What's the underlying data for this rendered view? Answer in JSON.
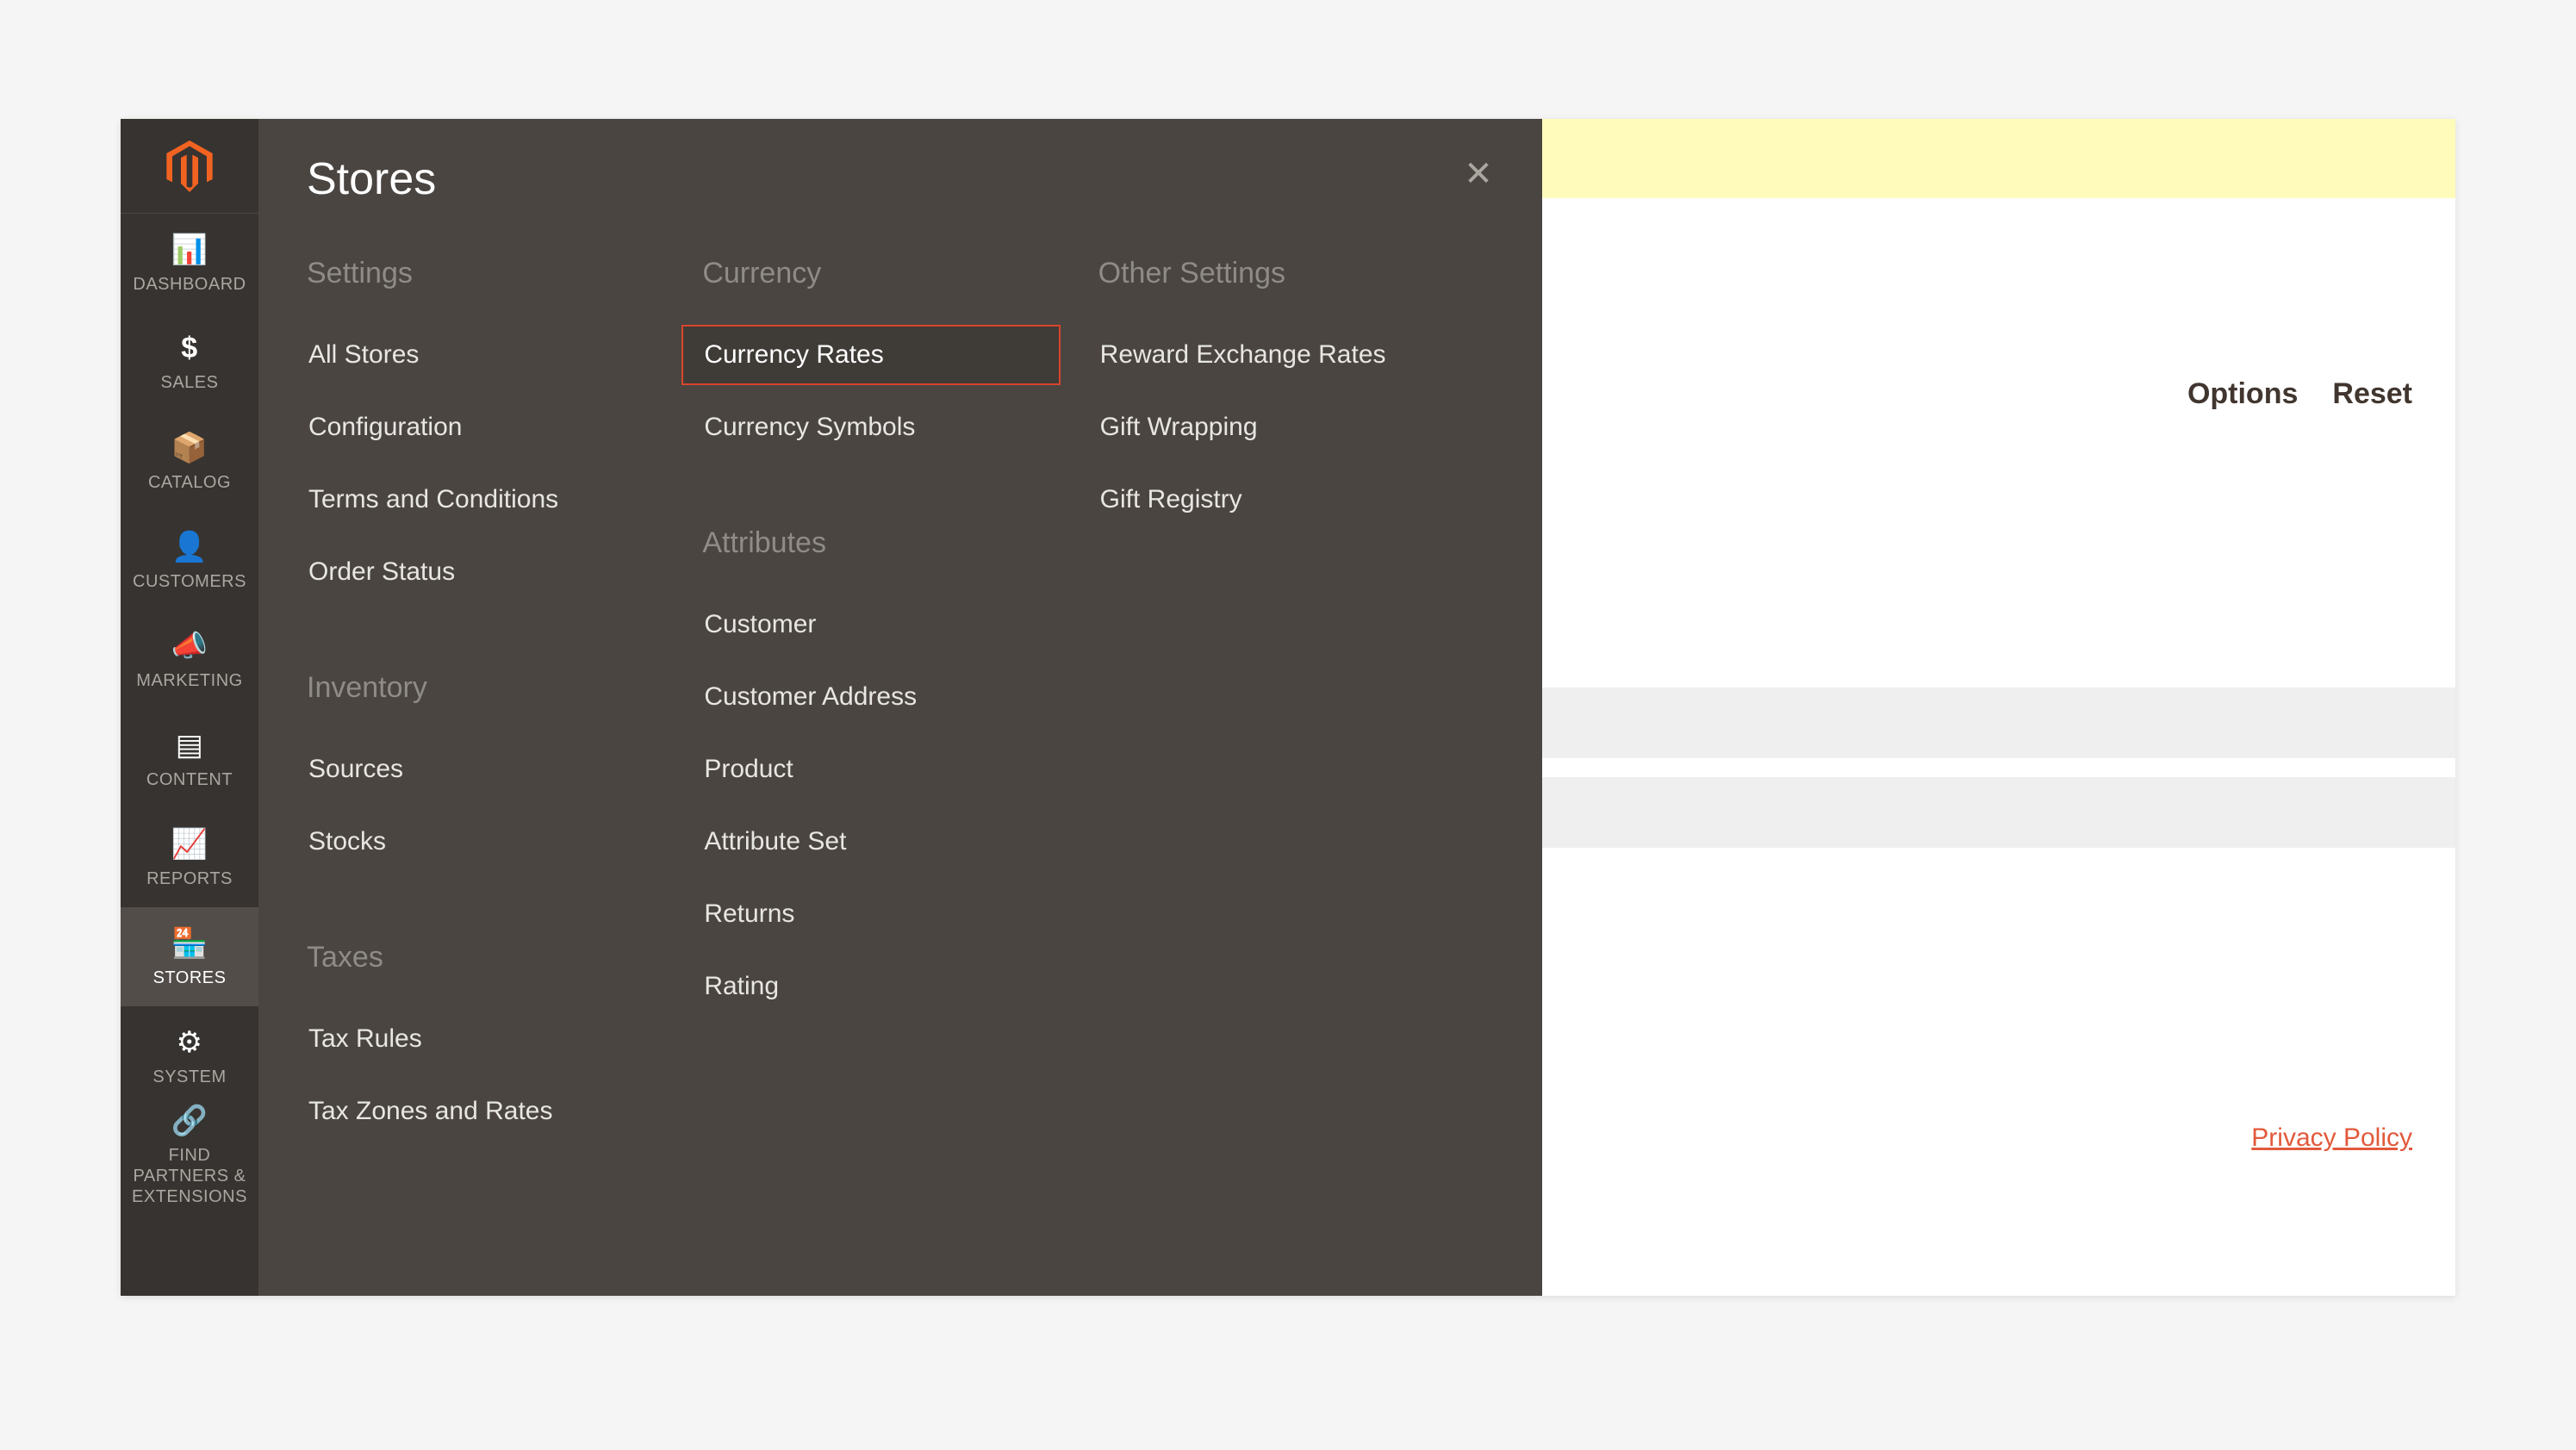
{
  "flyout": {
    "title": "Stores",
    "columns": [
      {
        "groups": [
          {
            "title": "Settings",
            "items": [
              {
                "label": "All Stores",
                "name": "link-all-stores"
              },
              {
                "label": "Configuration",
                "name": "link-configuration"
              },
              {
                "label": "Terms and Conditions",
                "name": "link-terms-and-conditions"
              },
              {
                "label": "Order Status",
                "name": "link-order-status"
              }
            ]
          },
          {
            "title": "Inventory",
            "items": [
              {
                "label": "Sources",
                "name": "link-sources"
              },
              {
                "label": "Stocks",
                "name": "link-stocks"
              }
            ]
          },
          {
            "title": "Taxes",
            "items": [
              {
                "label": "Tax Rules",
                "name": "link-tax-rules"
              },
              {
                "label": "Tax Zones and Rates",
                "name": "link-tax-zones-and-rates"
              }
            ]
          }
        ]
      },
      {
        "groups": [
          {
            "title": "Currency",
            "items": [
              {
                "label": "Currency Rates",
                "name": "link-currency-rates",
                "highlighted": true
              },
              {
                "label": "Currency Symbols",
                "name": "link-currency-symbols"
              }
            ]
          },
          {
            "title": "Attributes",
            "items": [
              {
                "label": "Customer",
                "name": "link-customer"
              },
              {
                "label": "Customer Address",
                "name": "link-customer-address"
              },
              {
                "label": "Product",
                "name": "link-product"
              },
              {
                "label": "Attribute Set",
                "name": "link-attribute-set"
              },
              {
                "label": "Returns",
                "name": "link-returns"
              },
              {
                "label": "Rating",
                "name": "link-rating"
              }
            ]
          }
        ]
      },
      {
        "groups": [
          {
            "title": "Other Settings",
            "items": [
              {
                "label": "Reward Exchange Rates",
                "name": "link-reward-exchange-rates"
              },
              {
                "label": "Gift Wrapping",
                "name": "link-gift-wrapping"
              },
              {
                "label": "Gift Registry",
                "name": "link-gift-registry"
              }
            ]
          }
        ]
      }
    ]
  },
  "nav": {
    "items": [
      {
        "label": "DASHBOARD",
        "name": "nav-dashboard",
        "icon": "gauge-icon"
      },
      {
        "label": "SALES",
        "name": "nav-sales",
        "icon": "dollar-icon"
      },
      {
        "label": "CATALOG",
        "name": "nav-catalog",
        "icon": "box-icon"
      },
      {
        "label": "CUSTOMERS",
        "name": "nav-customers",
        "icon": "person-icon"
      },
      {
        "label": "MARKETING",
        "name": "nav-marketing",
        "icon": "megaphone-icon"
      },
      {
        "label": "CONTENT",
        "name": "nav-content",
        "icon": "page-icon"
      },
      {
        "label": "REPORTS",
        "name": "nav-reports",
        "icon": "bars-icon"
      },
      {
        "label": "STORES",
        "name": "nav-stores",
        "icon": "storefront-icon",
        "active": true
      },
      {
        "label": "SYSTEM",
        "name": "nav-system",
        "icon": "gear-icon"
      },
      {
        "label": "FIND PARTNERS & EXTENSIONS",
        "name": "nav-partners",
        "icon": "link-icon"
      }
    ]
  },
  "page": {
    "options_label": "Options",
    "reset_label": "Reset",
    "privacy_label": "Privacy Policy"
  }
}
